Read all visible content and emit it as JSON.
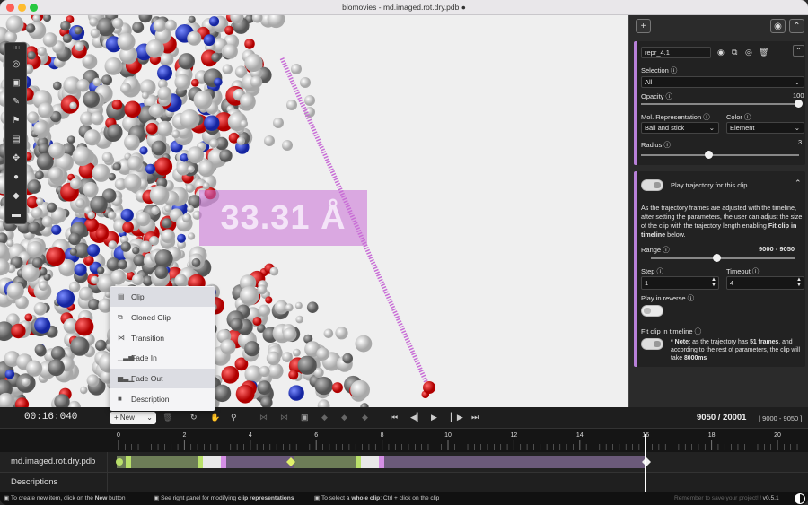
{
  "window": {
    "title": "biomovies - md.imaged.rot.dry.pdb ●"
  },
  "viewport": {
    "measurement": "33.31 Å"
  },
  "left_toolbar": {
    "icons": [
      "drag-handle-icon",
      "target-icon",
      "image-icon",
      "ruler-icon",
      "tag-icon",
      "calendar-icon",
      "move-icon",
      "comment-icon",
      "diamond-icon",
      "menu-icon"
    ]
  },
  "right_panel": {
    "add_label": "+",
    "repr": {
      "name": "repr_4.1",
      "selection_label": "Selection ⓘ",
      "selection_value": "All",
      "opacity_label": "Opacity ⓘ",
      "opacity_value": "100",
      "opacity_fraction": 1.0,
      "mol_repr_label": "Mol. Representation ⓘ",
      "mol_repr_value": "Ball and stick",
      "color_label": "Color ⓘ",
      "color_value": "Element",
      "radius_label": "Radius ⓘ",
      "radius_value": "3"
    },
    "trajectory": {
      "toggle_label": "Play trajectory for this clip",
      "description_1": "As the trajectory frames are adjusted with the timeline, after setting the parameters, the user can adjust the size of the clip with the trajectory length enabling ",
      "description_bold": "Fit clip in timeline",
      "description_2": " below.",
      "range_label": "Range ⓘ",
      "range_value": "9000  -  9050",
      "step_label": "Step ⓘ",
      "step_value": "1",
      "timeout_label": "Timeout ⓘ",
      "timeout_value": "4",
      "reverse_label": "Play in reverse ⓘ",
      "fit_label": "Fit clip in timeline ⓘ",
      "note_prefix": "* Note:",
      "note_1": " as the trajectory has ",
      "note_frames": "51 frames",
      "note_2": ", and according to the rest of parameters, the clip will take ",
      "note_time": "8000ms"
    }
  },
  "context_menu": {
    "items": [
      {
        "label": "Clip",
        "icon": "film-icon"
      },
      {
        "label": "Cloned Clip",
        "icon": "copy-icon"
      },
      {
        "label": "Transition",
        "icon": "transition-icon"
      },
      {
        "label": "Fade In",
        "icon": "fade-in-icon"
      },
      {
        "label": "Fade Out",
        "icon": "fade-out-icon"
      },
      {
        "label": "Description",
        "icon": "comment-icon"
      }
    ]
  },
  "timeline": {
    "time": "00:16:040",
    "new_label": "+ New",
    "frame": "9050 / 20001",
    "frame_range": "[ 9000 - 9050 ]",
    "ticks": [
      "0",
      "2",
      "4",
      "6",
      "8",
      "10",
      "12",
      "14",
      "16",
      "18",
      "20"
    ],
    "playhead": 16.0,
    "tracks": [
      "md.imaged.rot.dry.pdb",
      "Descriptions"
    ]
  },
  "status": {
    "hint1_a": "To create new item, click on the ",
    "hint1_b": "New",
    "hint1_c": " button",
    "hint2_a": "See right panel for modifying ",
    "hint2_b": "clip representations",
    "hint3_a": "To select a ",
    "hint3_b": "whole clip",
    "hint3_c": ": Ctrl + click on the clip",
    "reminder": "Remember to save your project!",
    "version": "v0.5.1"
  },
  "colors": {
    "accent": "#b880d8",
    "measure": "#c86ed6"
  }
}
